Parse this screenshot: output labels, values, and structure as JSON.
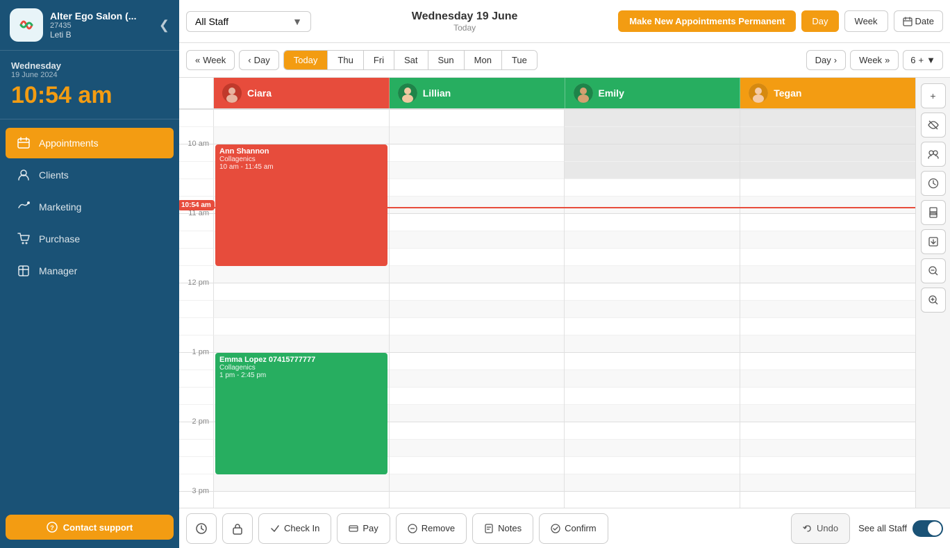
{
  "sidebar": {
    "salon_name": "Alter Ego Salon (...",
    "salon_id": "27435",
    "user": "Leti B",
    "day": "Wednesday",
    "date": "19 June 2024",
    "clock": "10:54 am",
    "nav_items": [
      {
        "id": "appointments",
        "label": "Appointments",
        "active": true
      },
      {
        "id": "clients",
        "label": "Clients",
        "active": false
      },
      {
        "id": "marketing",
        "label": "Marketing",
        "active": false
      },
      {
        "id": "purchase",
        "label": "Purchase",
        "active": false
      },
      {
        "id": "manager",
        "label": "Manager",
        "active": false
      }
    ],
    "contact_support": "Contact support"
  },
  "topbar": {
    "staff_select": "All Staff",
    "date_main": "Wednesday 19 June",
    "date_sub": "Today",
    "perm_btn": "Make New Appointments Permanent",
    "view_day": "Day",
    "view_week": "Week",
    "date_btn": "Date"
  },
  "navbar": {
    "week_back": "Week",
    "day_back": "Day",
    "tabs": [
      "Today",
      "Thu",
      "Fri",
      "Sat",
      "Sun",
      "Mon",
      "Tue"
    ],
    "active_tab": "Today",
    "day_fwd": "Day",
    "week_fwd": "Week",
    "num": "6"
  },
  "staff_columns": [
    {
      "name": "Ciara",
      "color": "ciara"
    },
    {
      "name": "Lillian",
      "color": "lillian"
    },
    {
      "name": "Emily",
      "color": "emily"
    },
    {
      "name": "Tegan",
      "color": "tegan"
    }
  ],
  "appointments": [
    {
      "id": "ann",
      "col": 0,
      "name": "Ann Shannon",
      "service": "Collagenics",
      "time_range": "10 am - 11:45 am",
      "color": "red",
      "top_slot": 10,
      "duration_slots": 7
    },
    {
      "id": "emma",
      "col": 0,
      "name": "Emma Lopez 07415777777",
      "service": "Collagenics",
      "time_range": "1 pm - 2:45 pm",
      "color": "green",
      "top_slot": 22,
      "duration_slots": 7
    }
  ],
  "time_indicator": {
    "label": "10:54 am",
    "slot": 6.9
  },
  "time_slots": [
    "10 am",
    "",
    "",
    "",
    "11 am",
    "",
    "",
    "",
    "12 pm",
    "",
    "",
    "",
    "1 pm",
    "",
    "",
    "",
    "2 pm",
    "",
    "",
    ""
  ],
  "bottom_bar": {
    "check_in": "Check In",
    "pay": "Pay",
    "remove": "Remove",
    "notes": "Notes",
    "confirm": "Confirm",
    "undo": "Undo",
    "see_all_staff": "See all Staff"
  }
}
